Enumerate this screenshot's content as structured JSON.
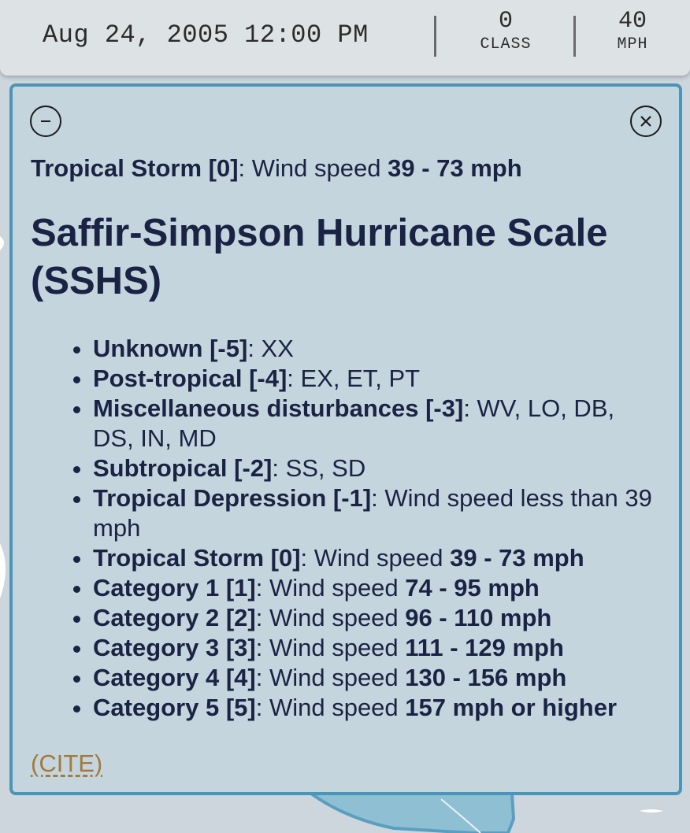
{
  "status": {
    "date": "Aug 24, 2005 12:00 PM",
    "class_value": "0",
    "class_unit": "CLASS",
    "speed_value": "40",
    "speed_unit": "MPH"
  },
  "panel": {
    "summary": {
      "name": "Tropical Storm [0]",
      "prefix": ": Wind speed ",
      "speed": "39 - 73 mph"
    },
    "title": "Saffir-Simpson Hurricane Scale (SSHS)",
    "items": [
      {
        "name": "Unknown [-5]",
        "text": ": XX",
        "bold": ""
      },
      {
        "name": "Post-tropical [-4]",
        "text": ": EX, ET, PT",
        "bold": ""
      },
      {
        "name": "Miscellaneous disturbances [-3]",
        "text": ": WV, LO, DB, DS, IN, MD",
        "bold": ""
      },
      {
        "name": "Subtropical [-2]",
        "text": ": SS, SD",
        "bold": ""
      },
      {
        "name": "Tropical Depression [-1]",
        "text": ": Wind speed less than 39 mph",
        "bold": ""
      },
      {
        "name": "Tropical Storm [0]",
        "text": ": Wind speed ",
        "bold": "39 - 73 mph"
      },
      {
        "name": "Category 1 [1]",
        "text": ": Wind speed ",
        "bold": "74 - 95 mph"
      },
      {
        "name": "Category 2 [2]",
        "text": ": Wind speed ",
        "bold": "96 - 110 mph"
      },
      {
        "name": "Category 3 [3]",
        "text": ": Wind speed ",
        "bold": "111 - 129 mph"
      },
      {
        "name": "Category 4 [4]",
        "text": ": Wind speed ",
        "bold": "130 - 156 mph"
      },
      {
        "name": "Category 5 [5]",
        "text": ": Wind speed ",
        "bold": "157 mph or higher"
      }
    ],
    "cite_label": "(CITE)",
    "minimize_icon": "minus-circle-icon",
    "close_icon": "close-circle-icon"
  },
  "colors": {
    "panel_border": "#4b95b8",
    "text": "#1b2344",
    "cite": "#a47a3c",
    "land": "#5b9fc0"
  }
}
